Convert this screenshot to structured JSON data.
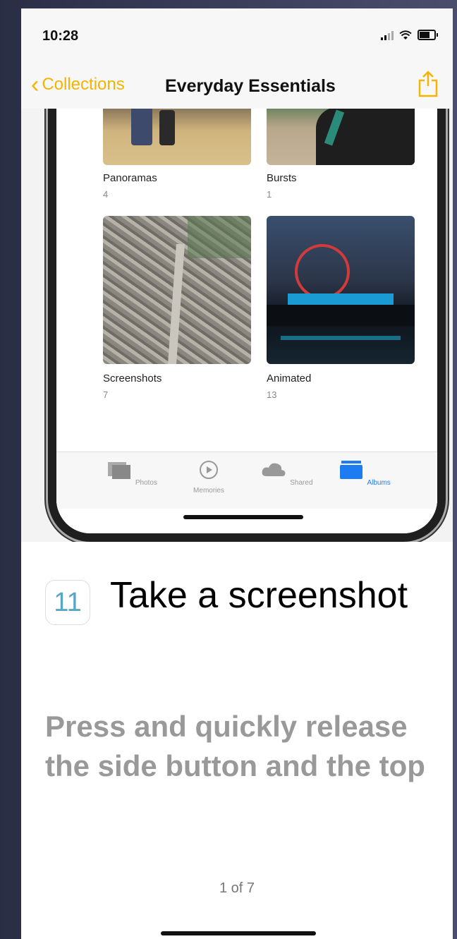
{
  "status": {
    "time": "10:28"
  },
  "nav": {
    "back_label": "Collections",
    "title": "Everyday Essentials"
  },
  "albums": [
    {
      "name": "Panoramas",
      "count": "4"
    },
    {
      "name": "Bursts",
      "count": "1"
    },
    {
      "name": "Screenshots",
      "count": "7"
    },
    {
      "name": "Animated",
      "count": "13"
    }
  ],
  "tabs": [
    {
      "label": "Photos",
      "active": false
    },
    {
      "label": "Memories",
      "active": false
    },
    {
      "label": "Shared",
      "active": false
    },
    {
      "label": "Albums",
      "active": true
    }
  ],
  "tip": {
    "badge": "11",
    "title": "Take a screenshot",
    "description": "Press and quickly release the side button and the top",
    "pager": "1 of 7"
  },
  "colors": {
    "accent": "#f5b400",
    "tab_active": "#1e7cf2"
  }
}
